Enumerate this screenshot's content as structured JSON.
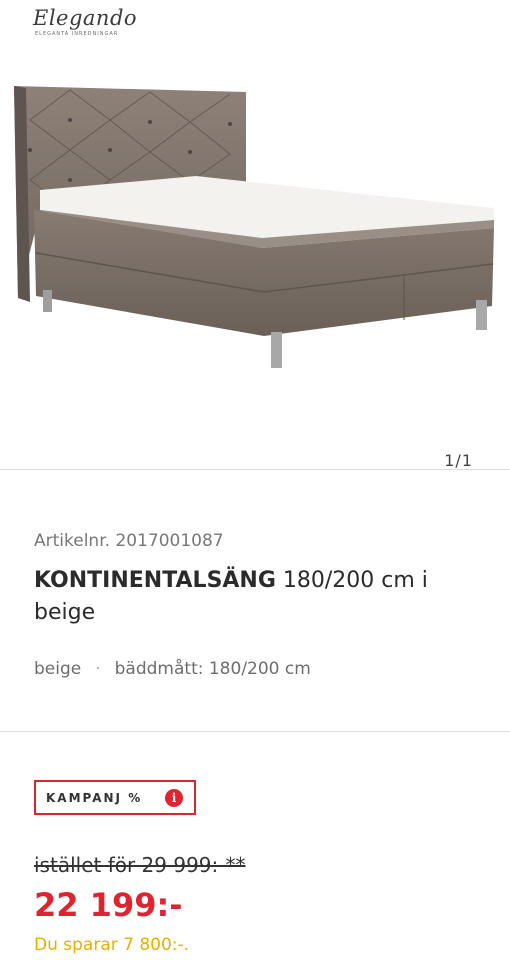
{
  "brand": {
    "name": "Elegando",
    "tagline": "ELEGANTA INREDNINGAR"
  },
  "gallery": {
    "counter": "1/1"
  },
  "product": {
    "article_label": "Artikelnr. 2017001087",
    "title_bold": "KONTINENTALSÄNG",
    "title_rest": " 180/200 cm i beige",
    "attr_color": "beige",
    "attr_sep": "·",
    "attr_size": "bäddmått: 180/200 cm"
  },
  "pricing": {
    "campaign_label": "KAMPANJ %",
    "info_symbol": "i",
    "old_price": "istället för 29 999:-**",
    "price": "22 199:-",
    "savings": "Du sparar 7 800:-."
  },
  "colors": {
    "accent": "#e0242f",
    "savings": "#e6b000"
  }
}
